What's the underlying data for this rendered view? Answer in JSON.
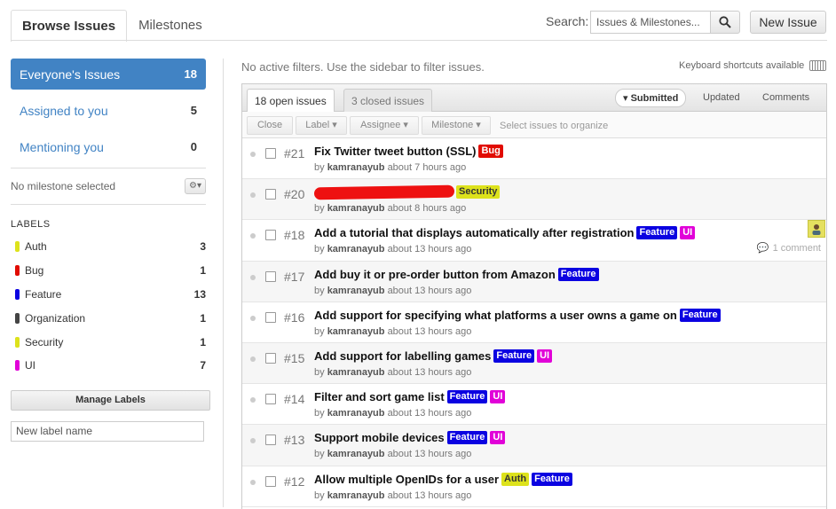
{
  "top_tabs": [
    {
      "label": "Browse Issues",
      "active": true
    },
    {
      "label": "Milestones",
      "active": false
    }
  ],
  "search": {
    "label": "Search:",
    "placeholder": "Issues & Milestones..."
  },
  "new_issue_label": "New Issue",
  "sidebar": {
    "nav": [
      {
        "label": "Everyone's Issues",
        "count": "18",
        "active": true
      },
      {
        "label": "Assigned to you",
        "count": "5",
        "active": false
      },
      {
        "label": "Mentioning you",
        "count": "0",
        "active": false
      }
    ],
    "milestone_text": "No milestone selected",
    "labels_heading": "LABELS",
    "labels": [
      {
        "name": "Auth",
        "count": "3",
        "color": "#dde21c"
      },
      {
        "name": "Bug",
        "count": "1",
        "color": "#e10c02"
      },
      {
        "name": "Feature",
        "count": "13",
        "color": "#0b02e1"
      },
      {
        "name": "Organization",
        "count": "1",
        "color": "#444444"
      },
      {
        "name": "Security",
        "count": "1",
        "color": "#dde21c"
      },
      {
        "name": "UI",
        "count": "7",
        "color": "#e102d8"
      }
    ],
    "manage_labels": "Manage Labels",
    "new_label_placeholder": "New label name"
  },
  "filters_text": "No active filters. Use the sidebar to filter issues.",
  "keyboard_shortcuts": "Keyboard shortcuts available",
  "state_tabs": [
    {
      "label": "18 open issues",
      "active": true
    },
    {
      "label": "3 closed issues",
      "active": false
    }
  ],
  "sorts": [
    {
      "label": "Submitted",
      "active": true
    },
    {
      "label": "Updated",
      "active": false
    },
    {
      "label": "Comments",
      "active": false
    }
  ],
  "toolbar": {
    "close": "Close",
    "label": "Label",
    "assignee": "Assignee",
    "milestone": "Milestone",
    "hint": "Select issues to organize"
  },
  "label_colors": {
    "Bug": {
      "bg": "#e10c02",
      "fg": "#ffffff"
    },
    "Security": {
      "bg": "#dde21c",
      "fg": "#333333"
    },
    "Feature": {
      "bg": "#0b02e1",
      "fg": "#ffffff"
    },
    "UI": {
      "bg": "#e102d8",
      "fg": "#ffffff"
    },
    "Auth": {
      "bg": "#dde21c",
      "fg": "#333333"
    }
  },
  "issues": [
    {
      "number": "#21",
      "title": "Fix Twitter tweet button (SSL)",
      "labels": [
        "Bug"
      ],
      "author": "kamranayub",
      "time": "about 7 hours ago",
      "redacted": false
    },
    {
      "number": "#20",
      "title": "",
      "labels": [
        "Security"
      ],
      "author": "kamranayub",
      "time": "about 8 hours ago",
      "redacted": true
    },
    {
      "number": "#18",
      "title": "Add a tutorial that displays automatically after registration",
      "labels": [
        "Feature",
        "UI"
      ],
      "author": "kamranayub",
      "time": "about 13 hours ago",
      "comments": "1 comment",
      "avatar": true
    },
    {
      "number": "#17",
      "title": "Add buy it or pre-order button from Amazon",
      "labels": [
        "Feature"
      ],
      "author": "kamranayub",
      "time": "about 13 hours ago"
    },
    {
      "number": "#16",
      "title": "Add support for specifying what platforms a user owns a game on",
      "labels": [
        "Feature"
      ],
      "author": "kamranayub",
      "time": "about 13 hours ago"
    },
    {
      "number": "#15",
      "title": "Add support for labelling games",
      "labels": [
        "Feature",
        "UI"
      ],
      "author": "kamranayub",
      "time": "about 13 hours ago"
    },
    {
      "number": "#14",
      "title": "Filter and sort game list",
      "labels": [
        "Feature",
        "UI"
      ],
      "author": "kamranayub",
      "time": "about 13 hours ago"
    },
    {
      "number": "#13",
      "title": "Support mobile devices",
      "labels": [
        "Feature",
        "UI"
      ],
      "author": "kamranayub",
      "time": "about 13 hours ago"
    },
    {
      "number": "#12",
      "title": "Allow multiple OpenIDs for a user",
      "labels": [
        "Auth",
        "Feature"
      ],
      "author": "kamranayub",
      "time": "about 13 hours ago"
    }
  ],
  "by_word": "by"
}
